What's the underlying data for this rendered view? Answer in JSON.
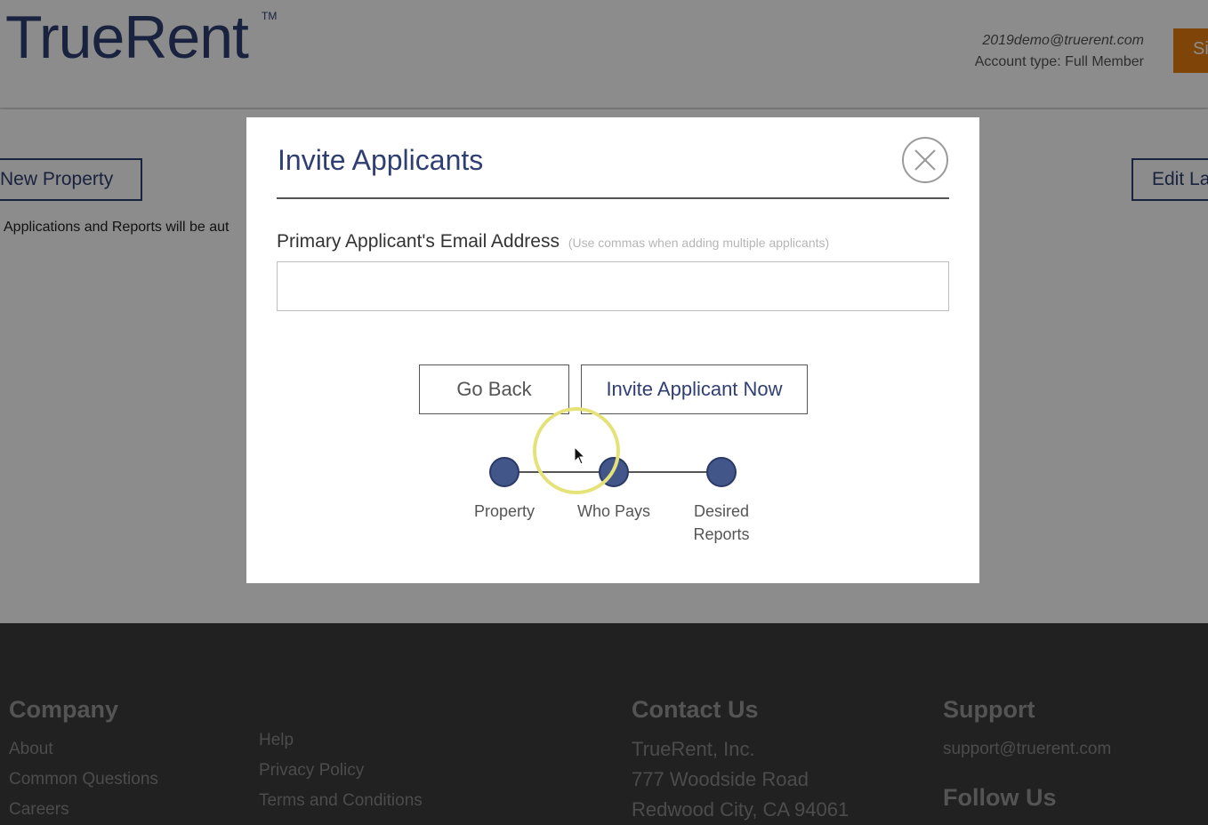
{
  "header": {
    "logo": "TrueRent",
    "trademark": "TM",
    "account_email": "2019demo@truerent.com",
    "account_type": "Account type: Full Member",
    "signout_label": "Si"
  },
  "page": {
    "new_property_label": "New Property",
    "edit_label": "Edit La",
    "notice": ": Applications and Reports will be aut"
  },
  "modal": {
    "title": "Invite Applicants",
    "field_label": "Primary Applicant's Email Address",
    "field_hint": "(Use commas when adding multiple applicants)",
    "email_value": "",
    "go_back_label": "Go Back",
    "invite_label": "Invite Applicant Now",
    "steps": [
      {
        "label": "Property"
      },
      {
        "label": "Who Pays"
      },
      {
        "label_line1": "Desired",
        "label_line2": "Reports"
      }
    ]
  },
  "footer": {
    "company_heading": "Company",
    "company_links": [
      "About",
      "Common Questions",
      "Careers"
    ],
    "more_links": [
      "Help",
      "Privacy Policy",
      "Terms and Conditions"
    ],
    "contact_heading": "Contact Us",
    "contact_lines": [
      "TrueRent, Inc.",
      "777 Woodside Road",
      "Redwood City, CA 94061"
    ],
    "support_heading": "Support",
    "support_email": "support@truerent.com",
    "follow_heading": "Follow Us"
  },
  "colors": {
    "brand_navy": "#2f3f73",
    "accent_orange": "#e87d10",
    "step_dot": "#42568a",
    "footer_bg": "#3c3c3c"
  },
  "icons": [
    "close-icon",
    "cursor-icon"
  ]
}
